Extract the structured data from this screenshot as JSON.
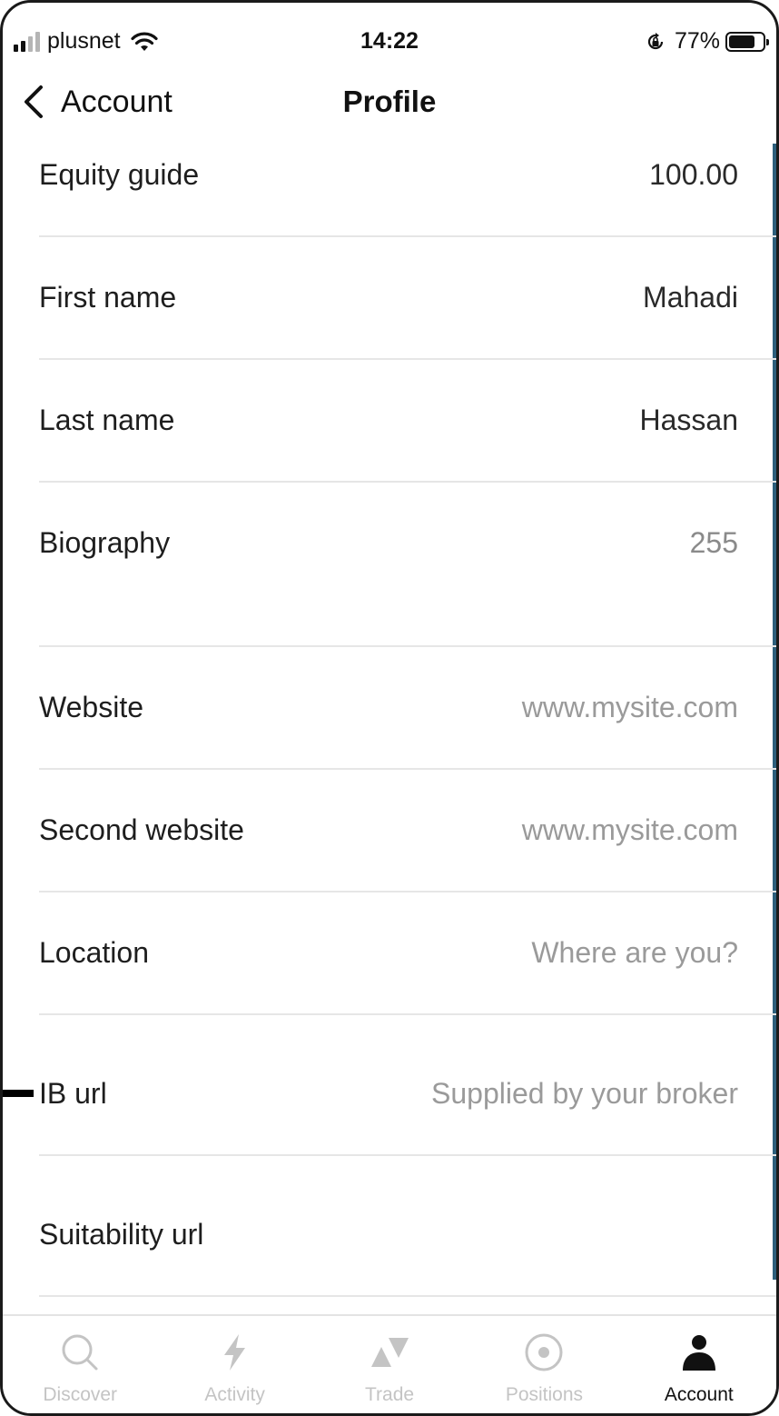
{
  "status_bar": {
    "carrier": "plusnet",
    "time": "14:22",
    "battery_percent": "77%",
    "battery_level": 0.77,
    "signal_bars_active": 2,
    "signal_bars_total": 4,
    "icons": [
      "signal-icon",
      "wifi-icon",
      "orientation-lock-icon",
      "battery-icon"
    ]
  },
  "nav": {
    "back_label": "Account",
    "title": "Profile",
    "back_icon": "chevron-left-icon"
  },
  "fields": [
    {
      "label": "Equity guide",
      "value": "100.00",
      "kind": "filled"
    },
    {
      "label": "First name",
      "value": "Mahadi",
      "kind": "filled"
    },
    {
      "label": "Last name",
      "value": "Hassan",
      "kind": "filled"
    },
    {
      "label": "Biography",
      "value": "255",
      "kind": "counter"
    },
    {
      "label": "Website",
      "value": "www.mysite.com",
      "kind": "placeholder"
    },
    {
      "label": "Second website",
      "value": "www.mysite.com",
      "kind": "placeholder"
    },
    {
      "label": "Location",
      "value": "Where are you?",
      "kind": "placeholder"
    },
    {
      "label": "IB url",
      "value": "Supplied by your broker",
      "kind": "placeholder"
    },
    {
      "label": "Suitability url",
      "value": "",
      "kind": "placeholder"
    }
  ],
  "tabs": [
    {
      "label": "Discover",
      "icon": "search-icon",
      "active": false
    },
    {
      "label": "Activity",
      "icon": "lightning-icon",
      "active": false
    },
    {
      "label": "Trade",
      "icon": "trade-triangles-icon",
      "active": false
    },
    {
      "label": "Positions",
      "icon": "target-circle-icon",
      "active": false
    },
    {
      "label": "Account",
      "icon": "person-icon",
      "active": true
    }
  ],
  "colors": {
    "text_primary": "#1e1e1e",
    "text_placeholder": "#9a9a9a",
    "tab_inactive": "#c4c4c4",
    "tab_active": "#111111",
    "divider": "#e6e6e6",
    "edge_accent": "#2c5f7c"
  }
}
